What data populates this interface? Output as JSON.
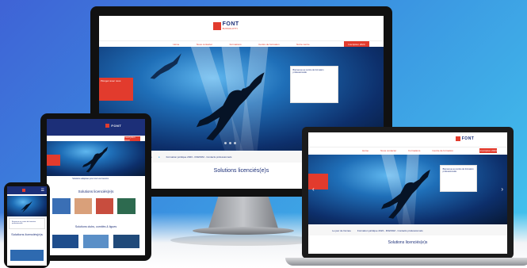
{
  "brand": {
    "logo_text": "FONT",
    "logo_sub": "BUSSOLOTTI",
    "accent": "#e23b2d",
    "navy": "#1c2f78"
  },
  "nav": {
    "items": [
      "Home",
      "Nous contacter",
      "Formations",
      "Centre de formation",
      "Notre centre"
    ],
    "cta": "Inscription 2023"
  },
  "hero": {
    "red_text": "Plongez avec nous",
    "card_text": "Bienvenue au centre de formation professionnelle"
  },
  "info": {
    "link": "Le jour de l'année",
    "tweet": "Formation juridique 2023 - FFESSM - Contacts professionnels"
  },
  "sections": {
    "licensed": "Solutions licenciés(e)s",
    "clubs": "Solutions clubs, comités & ligues"
  },
  "tablet": {
    "tagline": "Solutions adaptées pour tout vos besoins"
  }
}
